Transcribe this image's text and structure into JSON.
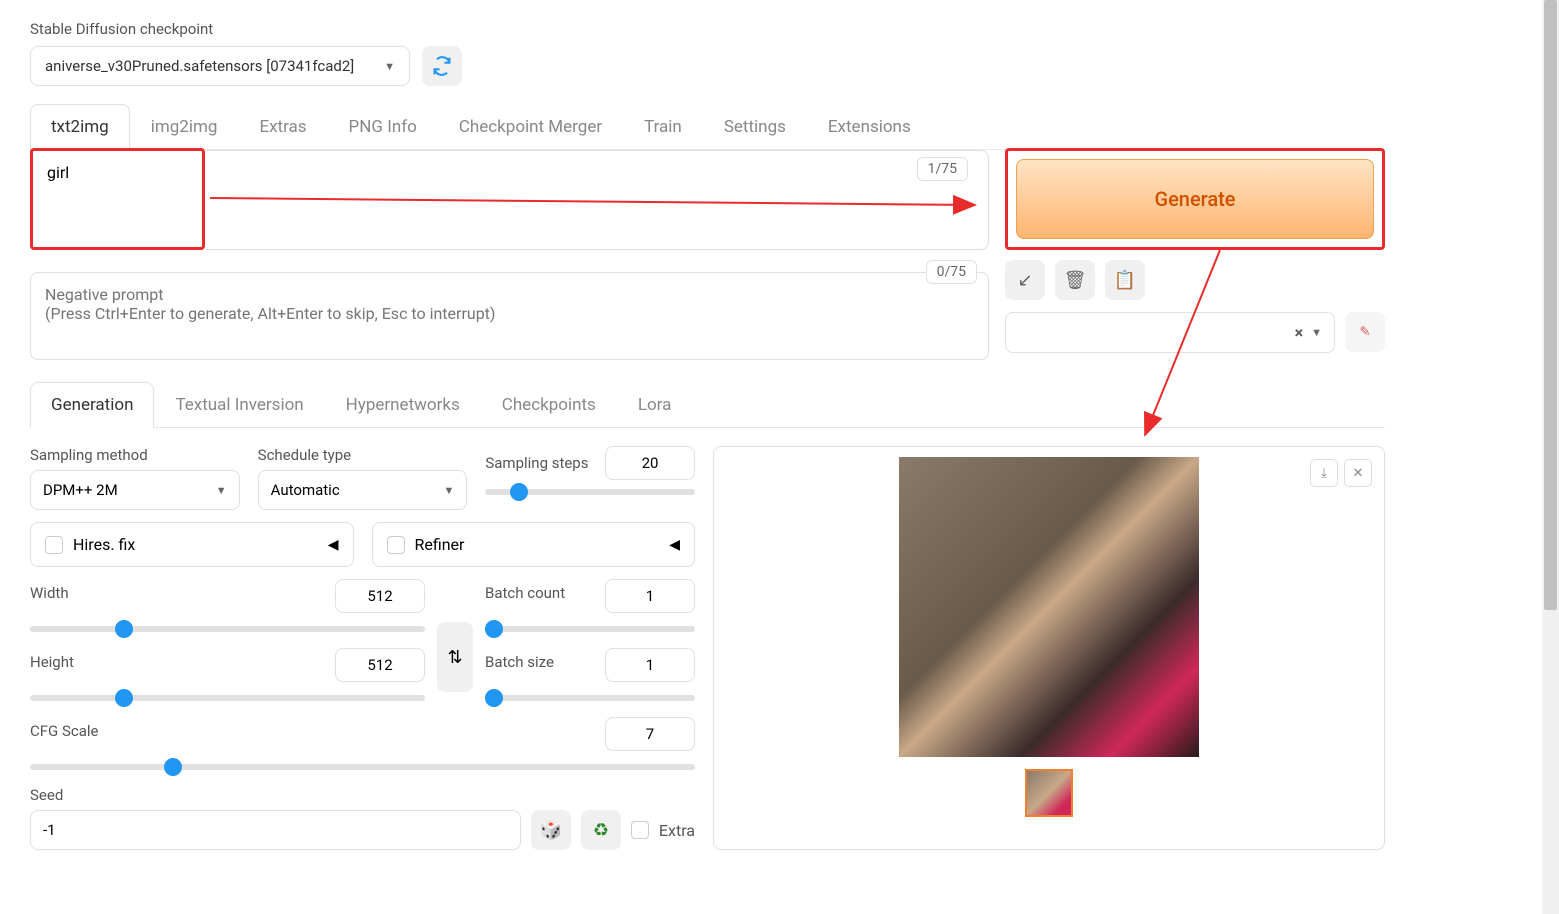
{
  "checkpoint": {
    "label": "Stable Diffusion checkpoint",
    "value": "aniverse_v30Pruned.safetensors [07341fcad2]"
  },
  "tabs": [
    "txt2img",
    "img2img",
    "Extras",
    "PNG Info",
    "Checkpoint Merger",
    "Train",
    "Settings",
    "Extensions"
  ],
  "active_tab": "txt2img",
  "prompt": {
    "value": "girl",
    "token_count": "1/75"
  },
  "neg_prompt": {
    "placeholder": "Negative prompt\n(Press Ctrl+Enter to generate, Alt+Enter to skip, Esc to interrupt)",
    "token_count": "0/75"
  },
  "generate_label": "Generate",
  "gen_tabs": [
    "Generation",
    "Textual Inversion",
    "Hypernetworks",
    "Checkpoints",
    "Lora"
  ],
  "active_gen_tab": "Generation",
  "settings": {
    "sampling_method": {
      "label": "Sampling method",
      "value": "DPM++ 2M"
    },
    "schedule_type": {
      "label": "Schedule type",
      "value": "Automatic"
    },
    "sampling_steps": {
      "label": "Sampling steps",
      "value": "20"
    },
    "hires_fix": {
      "label": "Hires. fix"
    },
    "refiner": {
      "label": "Refiner"
    },
    "width": {
      "label": "Width",
      "value": "512"
    },
    "height": {
      "label": "Height",
      "value": "512"
    },
    "batch_count": {
      "label": "Batch count",
      "value": "1"
    },
    "batch_size": {
      "label": "Batch size",
      "value": "1"
    },
    "cfg_scale": {
      "label": "CFG Scale",
      "value": "7"
    },
    "seed": {
      "label": "Seed",
      "value": "-1"
    },
    "extra": {
      "label": "Extra"
    }
  }
}
